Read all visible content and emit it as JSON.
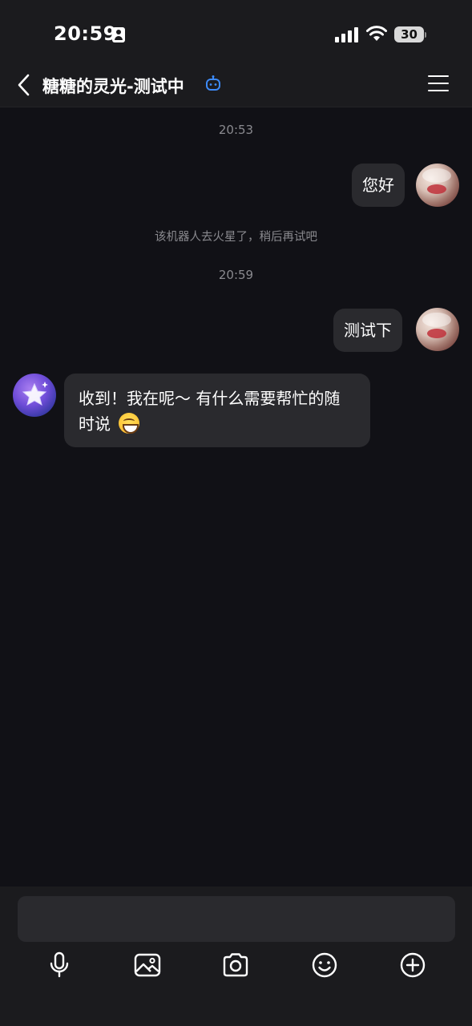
{
  "status_bar": {
    "time": "20:59",
    "battery": "30"
  },
  "header": {
    "title": "糖糖的灵光-测试中",
    "back_icon": "chevron-left-icon",
    "bot_icon": "robot-icon",
    "menu_icon": "hamburger-menu-icon"
  },
  "messages": {
    "timestamp_1": "20:53",
    "outgoing_1": "您好",
    "system_1": "该机器人去火星了，稍后再试吧",
    "timestamp_2": "20:59",
    "outgoing_2": "测试下",
    "incoming_1_line1": "收到！我在呢～ 有什么需要帮忙的随",
    "incoming_1_line2": "时说"
  },
  "input": {
    "placeholder": "",
    "tools": [
      "microphone-icon",
      "image-icon",
      "camera-icon",
      "emoji-icon",
      "plus-icon"
    ]
  },
  "colors": {
    "background": "#111116",
    "bar": "#1b1b1e",
    "bubble": "#2a2a2e",
    "bot_accent": "#3d8af7"
  }
}
